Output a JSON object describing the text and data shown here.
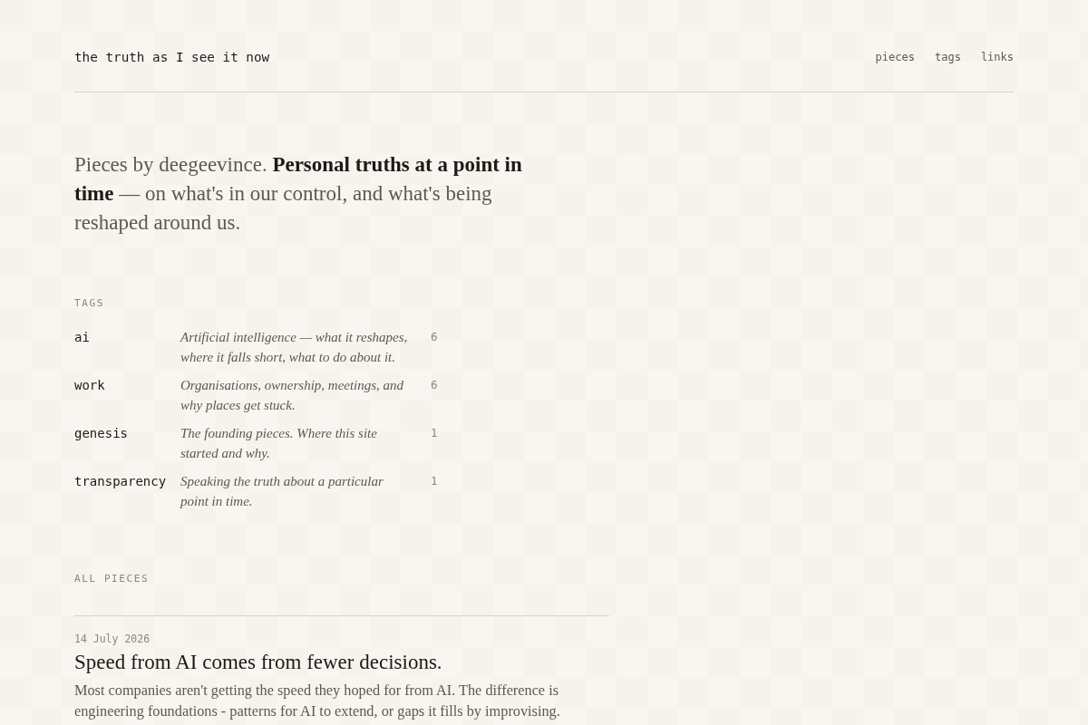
{
  "site": {
    "title": "the truth as I see it now",
    "nav": [
      {
        "label": "pieces"
      },
      {
        "label": "tags"
      },
      {
        "label": "links"
      }
    ]
  },
  "intro": "Pieces by deegeevince. **Personal truths at a point in time** — on what's in our control, and what's being reshaped around us.",
  "tags": {
    "heading": "TAGS",
    "items": [
      {
        "name": "ai",
        "description": "Artificial intelligence — what it reshapes, where it falls short, what to do about it.",
        "count": "6"
      },
      {
        "name": "work",
        "description": "Organisations, ownership, meetings, and why places get stuck.",
        "count": "6"
      },
      {
        "name": "genesis",
        "description": "The founding pieces. Where this site started and why.",
        "count": "1"
      },
      {
        "name": "transparency",
        "description": "Speaking the truth about a particular point in time.",
        "count": "1"
      }
    ]
  },
  "pieces": {
    "heading": "ALL PIECES",
    "items": [
      {
        "date": "14 July 2026",
        "title": "Speed from AI comes from fewer decisions.",
        "summary": "Most companies aren't getting the speed they hoped for from AI. The difference is engineering foundations - patterns for AI to extend, or gaps it fills by improvising."
      }
    ]
  }
}
